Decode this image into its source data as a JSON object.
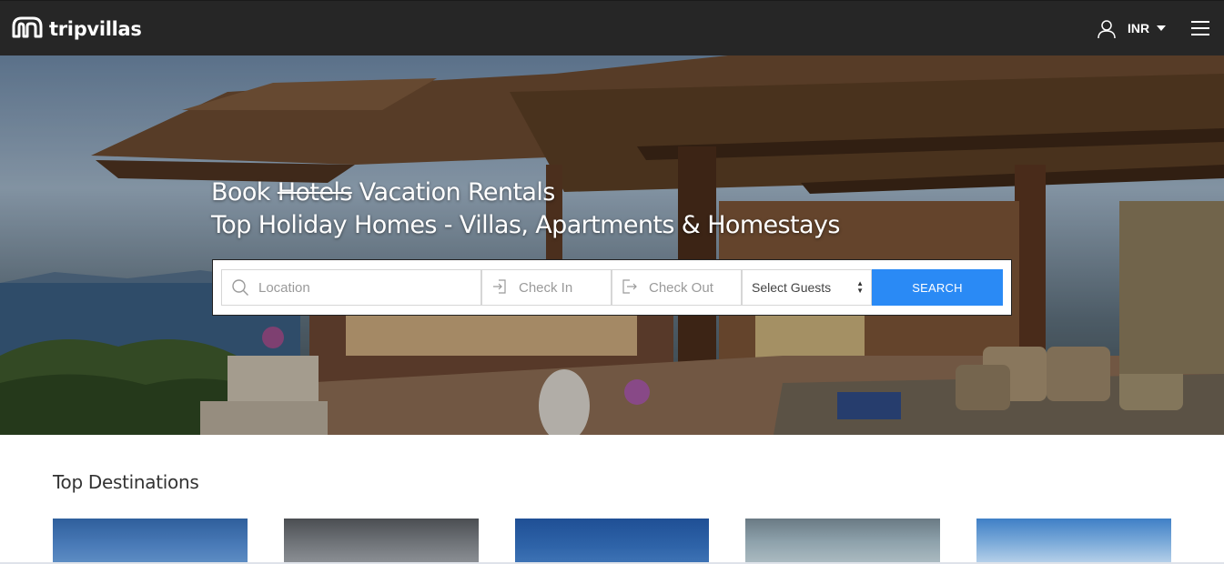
{
  "brand": {
    "name": "tripvillas"
  },
  "header": {
    "currency": "INR",
    "icons": {
      "user": "user-icon",
      "currency_caret": "caret-down-icon",
      "menu": "hamburger-menu-icon"
    }
  },
  "hero": {
    "headline": {
      "book": "Book",
      "struck": "Hotels",
      "rest": "Vacation Rentals",
      "line2": "Top Holiday Homes - Villas, Apartments & Homestays"
    },
    "search": {
      "location_placeholder": "Location",
      "checkin_placeholder": "Check In",
      "checkout_placeholder": "Check Out",
      "guests_selected": "Select Guests",
      "button_label": "SEARCH",
      "accent_color": "#2a8af5"
    }
  },
  "destinations": {
    "title": "Top Destinations"
  }
}
